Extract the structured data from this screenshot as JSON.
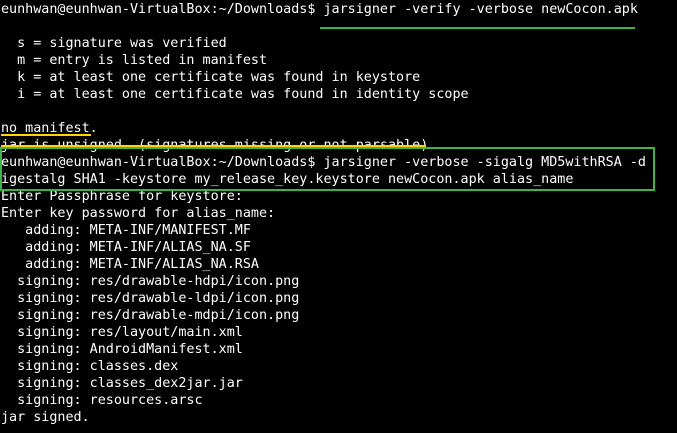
{
  "terminal": {
    "lines": [
      "eunhwan@eunhwan-VirtualBox:~/Downloads$ jarsigner -verify -verbose newCocon.apk",
      "",
      "  s = signature was verified",
      "  m = entry is listed in manifest",
      "  k = at least one certificate was found in keystore",
      "  i = at least one certificate was found in identity scope",
      "",
      "no manifest.",
      "jar is unsigned. (signatures missing or not parsable)",
      "eunhwan@eunhwan-VirtualBox:~/Downloads$ jarsigner -verbose -sigalg MD5withRSA -d",
      "igestalg SHA1 -keystore my_release_key.keystore newCocon.apk alias_name",
      "Enter Passphrase for keystore:",
      "Enter key password for alias_name:",
      "   adding: META-INF/MANIFEST.MF",
      "   adding: META-INF/ALIAS_NA.SF",
      "   adding: META-INF/ALIAS_NA.RSA",
      "  signing: res/drawable-hdpi/icon.png",
      "  signing: res/drawable-ldpi/icon.png",
      "  signing: res/drawable-mdpi/icon.png",
      "  signing: res/layout/main.xml",
      "  signing: AndroidManifest.xml",
      "  signing: classes.dex",
      "  signing: classes_dex2jar.jar",
      "  signing: resources.arsc",
      "jar signed."
    ]
  },
  "colors": {
    "background": "#000000",
    "text": "#ffffff",
    "highlight_box": "#39b54a",
    "annotation_line": "#ffd400"
  }
}
